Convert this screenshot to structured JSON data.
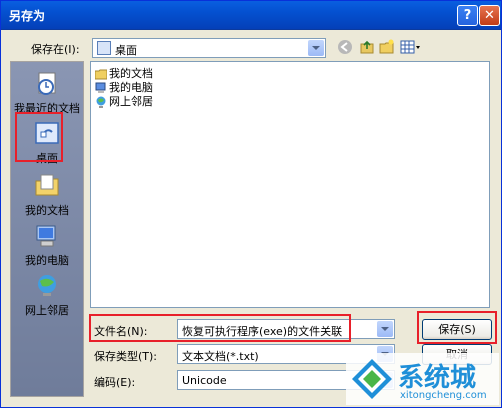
{
  "window": {
    "title": "另存为",
    "help_label": "?",
    "close_label": "✕"
  },
  "save_in": {
    "label": "保存在(I):",
    "value": "桌面"
  },
  "toolbar": {
    "back_icon": "back-icon",
    "up_icon": "up-folder-icon",
    "new_folder_icon": "new-folder-icon",
    "view_icon": "view-menu-icon"
  },
  "places": [
    {
      "label": "我最近的文档",
      "icon": "recent-documents-icon"
    },
    {
      "label": "桌面",
      "icon": "desktop-icon"
    },
    {
      "label": "我的文档",
      "icon": "my-documents-icon"
    },
    {
      "label": "我的电脑",
      "icon": "my-computer-icon"
    },
    {
      "label": "网上邻居",
      "icon": "network-places-icon"
    }
  ],
  "files": [
    {
      "name": "我的文档",
      "icon": "folder-icon"
    },
    {
      "name": "我的电脑",
      "icon": "computer-icon"
    },
    {
      "name": "网上邻居",
      "icon": "network-icon"
    }
  ],
  "filename": {
    "label": "文件名(N):",
    "value": "恢复可执行程序(exe)的文件关联"
  },
  "filetype": {
    "label": "保存类型(T):",
    "value": "文本文档(*.txt)"
  },
  "encoding": {
    "label": "编码(E):",
    "value": "Unicode"
  },
  "buttons": {
    "save": "保存(S)",
    "cancel": "取消"
  },
  "watermark": {
    "brand": "系统城",
    "url": "xitongcheng.com"
  },
  "colors": {
    "highlight": "#e8202a",
    "titlebar": "#0450d0"
  }
}
